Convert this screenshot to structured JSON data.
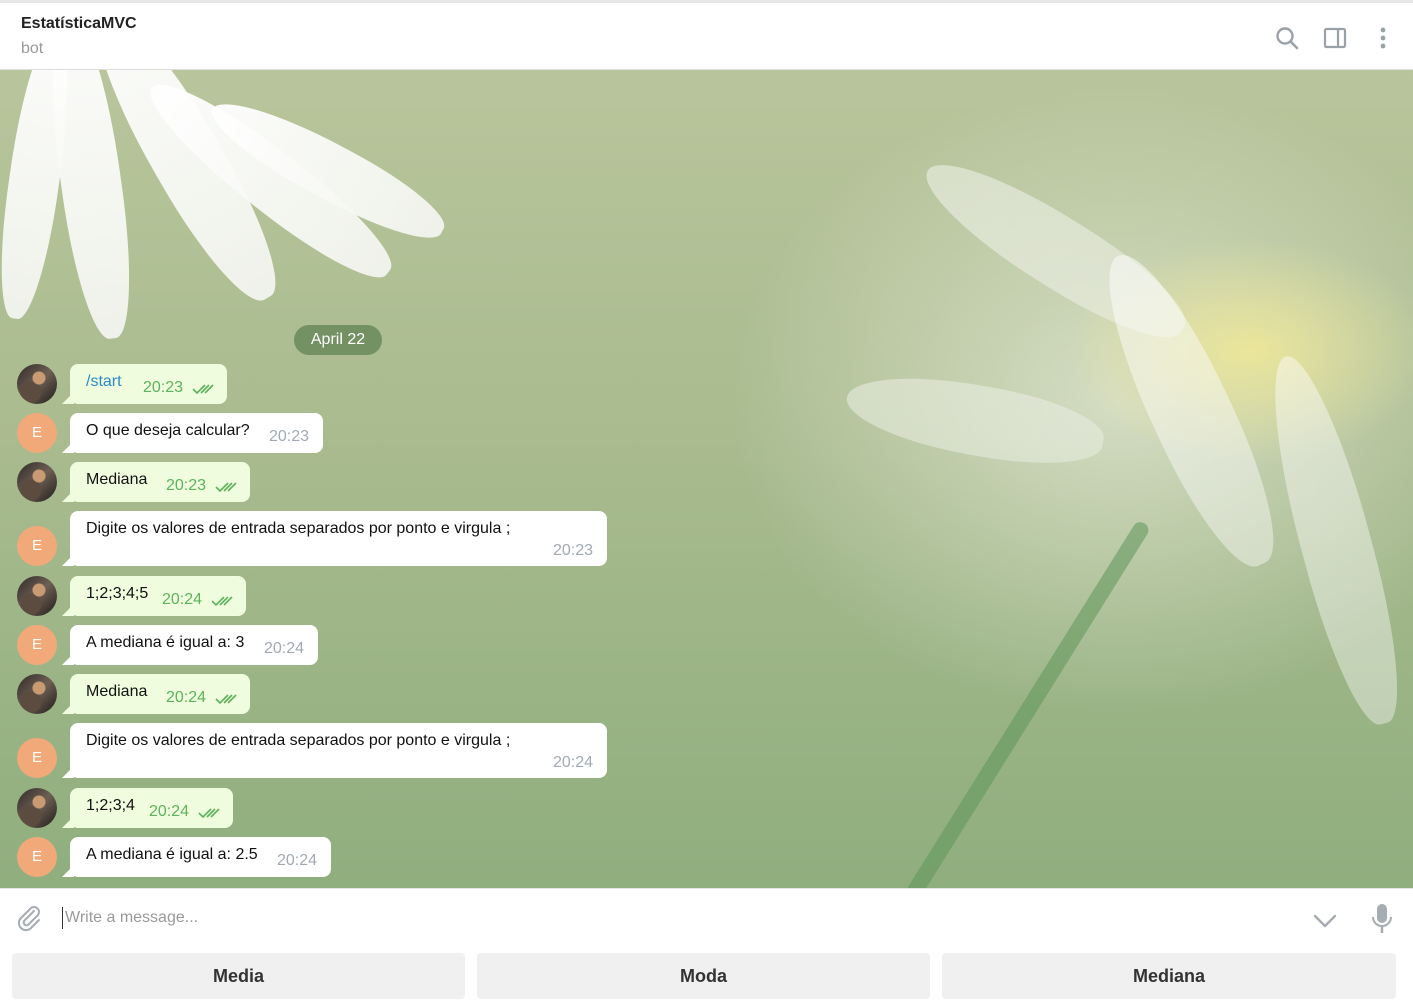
{
  "header": {
    "title": "EstatísticaMVC",
    "subtitle": "bot"
  },
  "icons": {
    "search": "search-icon",
    "panel": "side-panel-icon",
    "menu": "more-vertical-icon",
    "attach": "paperclip-icon",
    "scroll": "chevron-down-icon",
    "mic": "microphone-icon"
  },
  "date_badge": "April 22",
  "messages": [
    {
      "from": "user",
      "text": "/start",
      "time": "20:23",
      "read": true
    },
    {
      "from": "bot",
      "avatar_letter": "E",
      "text": "O que deseja calcular?",
      "time": "20:23"
    },
    {
      "from": "user",
      "text": "Mediana",
      "time": "20:23",
      "read": true
    },
    {
      "from": "bot",
      "avatar_letter": "E",
      "text": "Digite os valores de entrada separados por ponto e virgula ;",
      "time": "20:23"
    },
    {
      "from": "user",
      "text": "1;2;3;4;5",
      "time": "20:24",
      "read": true
    },
    {
      "from": "bot",
      "avatar_letter": "E",
      "text": "A mediana é igual a: 3",
      "time": "20:24"
    },
    {
      "from": "user",
      "text": "Mediana",
      "time": "20:24",
      "read": true
    },
    {
      "from": "bot",
      "avatar_letter": "E",
      "text": "Digite os valores de entrada separados por ponto e virgula ;",
      "time": "20:24"
    },
    {
      "from": "user",
      "text": "1;2;3;4",
      "time": "20:24",
      "read": true
    },
    {
      "from": "bot",
      "avatar_letter": "E",
      "text": "A mediana é igual a: 2.5",
      "time": "20:24"
    }
  ],
  "composer": {
    "placeholder": "Write a message..."
  },
  "keyboard": {
    "buttons": [
      "Media",
      "Moda",
      "Mediana"
    ]
  },
  "colors": {
    "outgoing_bubble": "#effdde",
    "incoming_bubble": "#ffffff",
    "bot_avatar": "#f2a97a",
    "read_check": "#5cb35c",
    "date_badge": "#688a5a"
  }
}
